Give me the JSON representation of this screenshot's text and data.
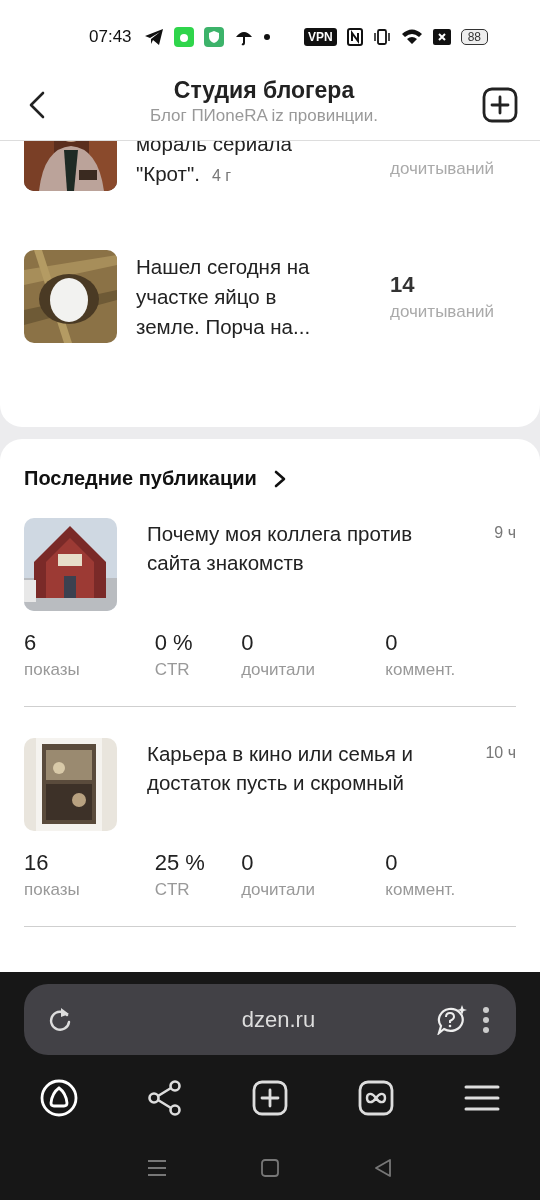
{
  "status_bar": {
    "time": "07:43",
    "vpn": "VPN",
    "battery": "88"
  },
  "header": {
    "title": "Студия блогера",
    "subtitle": "Блог ПИoneRA iz провинции."
  },
  "top_posts": [
    {
      "title_lines": [
        "мораль сериала",
        "\"Крот\"."
      ],
      "age": "4 г",
      "count_label": "дочитываний",
      "kind": "picture"
    },
    {
      "title_lines": [
        "Нашел сегодня на",
        "участке яйцо в",
        "земле. Порча на..."
      ],
      "count": "14",
      "count_label": "дочитываний",
      "kind": "picture"
    }
  ],
  "recent": {
    "heading": "Последние публикации",
    "posts": [
      {
        "title": "Почему моя коллега против сайта знакомств",
        "time": "9 ч",
        "stats": [
          {
            "value": "6",
            "label": "показы"
          },
          {
            "value": "0 %",
            "label": "CTR"
          },
          {
            "value": "0",
            "label": "дочитали"
          },
          {
            "value": "0",
            "label": "коммент."
          }
        ]
      },
      {
        "title": "Карьера в кино или семья и достаток пусть и скромный",
        "time": "10 ч",
        "stats": [
          {
            "value": "16",
            "label": "показы"
          },
          {
            "value": "25 %",
            "label": "CTR"
          },
          {
            "value": "0",
            "label": "дочитали"
          },
          {
            "value": "0",
            "label": "коммент."
          }
        ]
      }
    ]
  },
  "browser": {
    "url": "dzen.ru"
  }
}
